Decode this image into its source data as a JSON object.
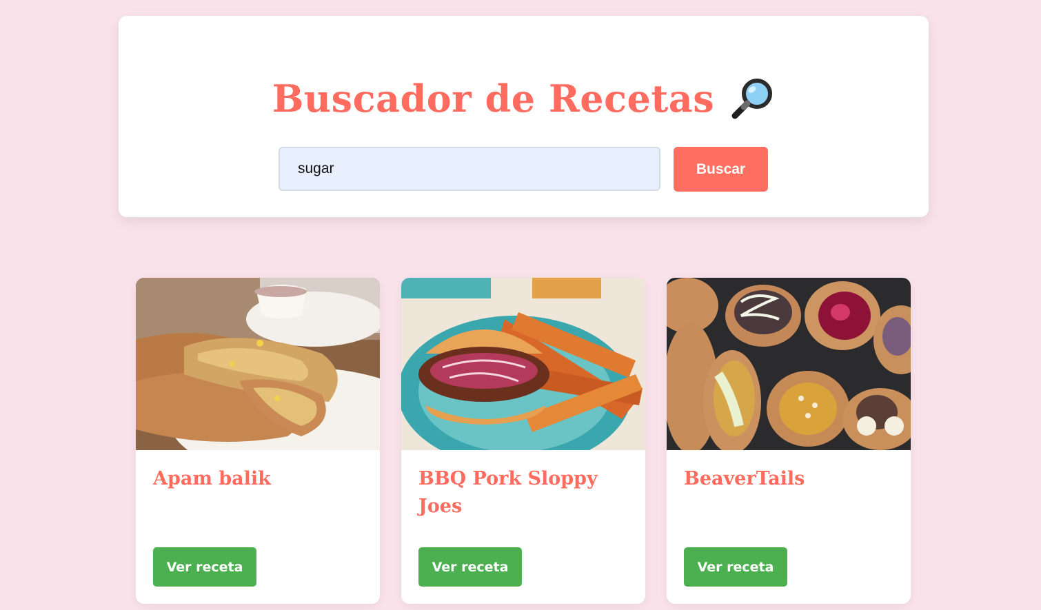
{
  "header": {
    "title": "Buscador de Recetas",
    "title_icon": "magnifying-glass-icon"
  },
  "search": {
    "value": "sugar",
    "placeholder": "",
    "button_label": "Buscar"
  },
  "colors": {
    "background": "#f9e2ea",
    "accent": "#ff6b5e",
    "search_button": "#ff6f61",
    "view_button": "#4caf50",
    "input_bg": "#e8f0fe"
  },
  "recipes": [
    {
      "title": "Apam balik",
      "button_label": "Ver receta",
      "image": "apam-balik-photo"
    },
    {
      "title": "BBQ Pork Sloppy Joes",
      "button_label": "Ver receta",
      "image": "bbq-pork-sloppy-joes-photo"
    },
    {
      "title": "BeaverTails",
      "button_label": "Ver receta",
      "image": "beavertails-photo"
    }
  ]
}
